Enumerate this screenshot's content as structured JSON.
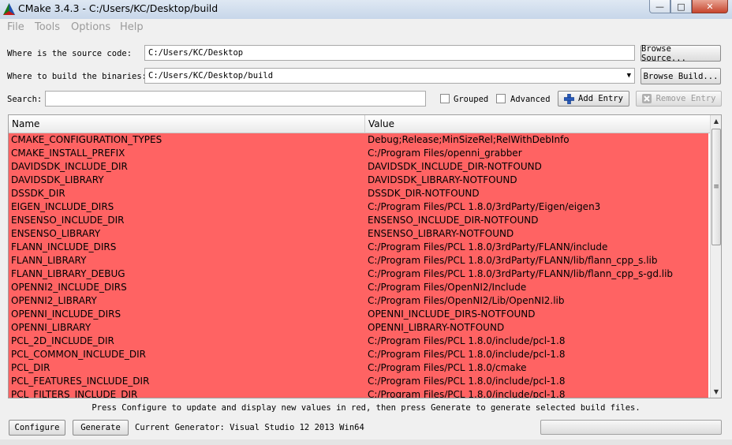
{
  "window": {
    "title": "CMake 3.4.3 - C:/Users/KC/Desktop/build",
    "minimize_glyph": "—",
    "maximize_glyph": "□",
    "close_glyph": "✕"
  },
  "menu": [
    "File",
    "Tools",
    "Options",
    "Help"
  ],
  "source": {
    "label": "Where is the source code:",
    "value": "C:/Users/KC/Desktop",
    "button": "Browse Source..."
  },
  "build": {
    "label": "Where to build the binaries:",
    "value": "C:/Users/KC/Desktop/build",
    "button": "Browse Build..."
  },
  "search": {
    "label": "Search:",
    "value": ""
  },
  "options": {
    "grouped": {
      "label": "Grouped",
      "checked": false
    },
    "advanced": {
      "label": "Advanced",
      "checked": false
    },
    "add_entry": "Add Entry",
    "remove_entry": "Remove Entry"
  },
  "table": {
    "columns": [
      "Name",
      "Value"
    ],
    "row_color": "#ff6363",
    "rows": [
      [
        "CMAKE_CONFIGURATION_TYPES",
        "Debug;Release;MinSizeRel;RelWithDebInfo"
      ],
      [
        "CMAKE_INSTALL_PREFIX",
        "C:/Program Files/openni_grabber"
      ],
      [
        "DAVIDSDK_INCLUDE_DIR",
        "DAVIDSDK_INCLUDE_DIR-NOTFOUND"
      ],
      [
        "DAVIDSDK_LIBRARY",
        "DAVIDSDK_LIBRARY-NOTFOUND"
      ],
      [
        "DSSDK_DIR",
        "DSSDK_DIR-NOTFOUND"
      ],
      [
        "EIGEN_INCLUDE_DIRS",
        "C:/Program Files/PCL 1.8.0/3rdParty/Eigen/eigen3"
      ],
      [
        "ENSENSO_INCLUDE_DIR",
        "ENSENSO_INCLUDE_DIR-NOTFOUND"
      ],
      [
        "ENSENSO_LIBRARY",
        "ENSENSO_LIBRARY-NOTFOUND"
      ],
      [
        "FLANN_INCLUDE_DIRS",
        "C:/Program Files/PCL 1.8.0/3rdParty/FLANN/include"
      ],
      [
        "FLANN_LIBRARY",
        "C:/Program Files/PCL 1.8.0/3rdParty/FLANN/lib/flann_cpp_s.lib"
      ],
      [
        "FLANN_LIBRARY_DEBUG",
        "C:/Program Files/PCL 1.8.0/3rdParty/FLANN/lib/flann_cpp_s-gd.lib"
      ],
      [
        "OPENNI2_INCLUDE_DIRS",
        "C:/Program Files/OpenNI2/Include"
      ],
      [
        "OPENNI2_LIBRARY",
        "C:/Program Files/OpenNI2/Lib/OpenNI2.lib"
      ],
      [
        "OPENNI_INCLUDE_DIRS",
        "OPENNI_INCLUDE_DIRS-NOTFOUND"
      ],
      [
        "OPENNI_LIBRARY",
        "OPENNI_LIBRARY-NOTFOUND"
      ],
      [
        "PCL_2D_INCLUDE_DIR",
        "C:/Program Files/PCL 1.8.0/include/pcl-1.8"
      ],
      [
        "PCL_COMMON_INCLUDE_DIR",
        "C:/Program Files/PCL 1.8.0/include/pcl-1.8"
      ],
      [
        "PCL_DIR",
        "C:/Program Files/PCL 1.8.0/cmake"
      ],
      [
        "PCL_FEATURES_INCLUDE_DIR",
        "C:/Program Files/PCL 1.8.0/include/pcl-1.8"
      ],
      [
        "PCL_FILTERS_INCLUDE_DIR",
        "C:/Program Files/PCL 1.8.0/include/pcl-1.8"
      ]
    ]
  },
  "hint": "Press Configure to update and display new values in red, then press Generate to generate selected build files.",
  "configure_button": "Configure",
  "generate_button": "Generate",
  "generator": "Current Generator: Visual Studio 12 2013 Win64",
  "scroll_glyphs": {
    "up": "▲",
    "down": "▼",
    "grip": "≡"
  }
}
